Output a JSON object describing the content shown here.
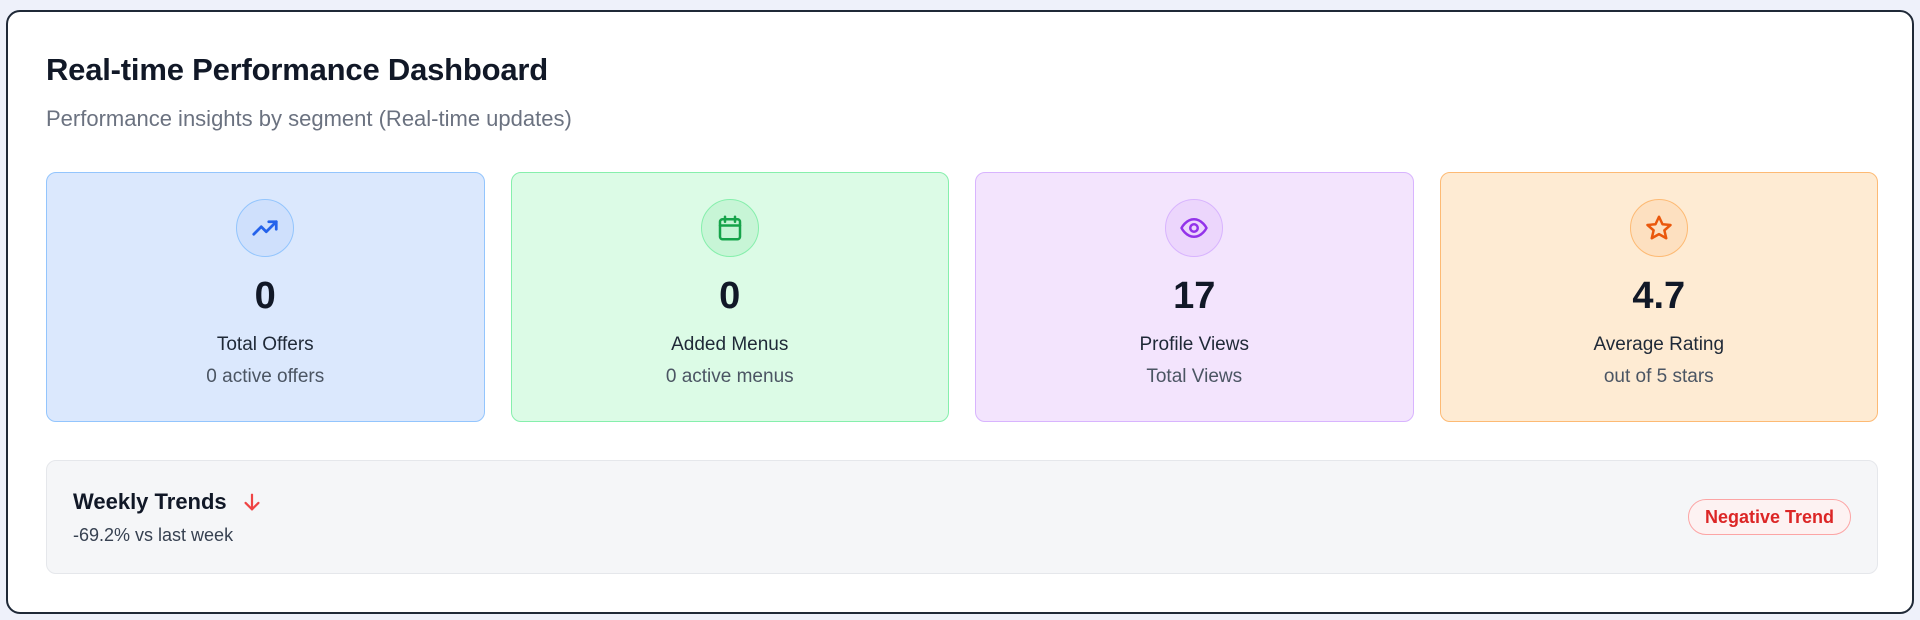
{
  "header": {
    "title": "Real-time Performance Dashboard",
    "subtitle": "Performance insights by segment (Real-time updates)"
  },
  "cards": [
    {
      "icon": "trending-up-icon",
      "value": "0",
      "label": "Total Offers",
      "sub": "0 active offers",
      "color": "#2563eb"
    },
    {
      "icon": "calendar-icon",
      "value": "0",
      "label": "Added Menus",
      "sub": "0 active menus",
      "color": "#16a34a"
    },
    {
      "icon": "eye-icon",
      "value": "17",
      "label": "Profile Views",
      "sub": "Total Views",
      "color": "#9333ea"
    },
    {
      "icon": "star-icon",
      "value": "4.7",
      "label": "Average Rating",
      "sub": "out of 5 stars",
      "color": "#ea580c"
    }
  ],
  "trends": {
    "title": "Weekly Trends",
    "change": "-69.2% vs last week",
    "badge": "Negative Trend",
    "icon": "arrow-down-icon",
    "color": "#dc2626"
  }
}
